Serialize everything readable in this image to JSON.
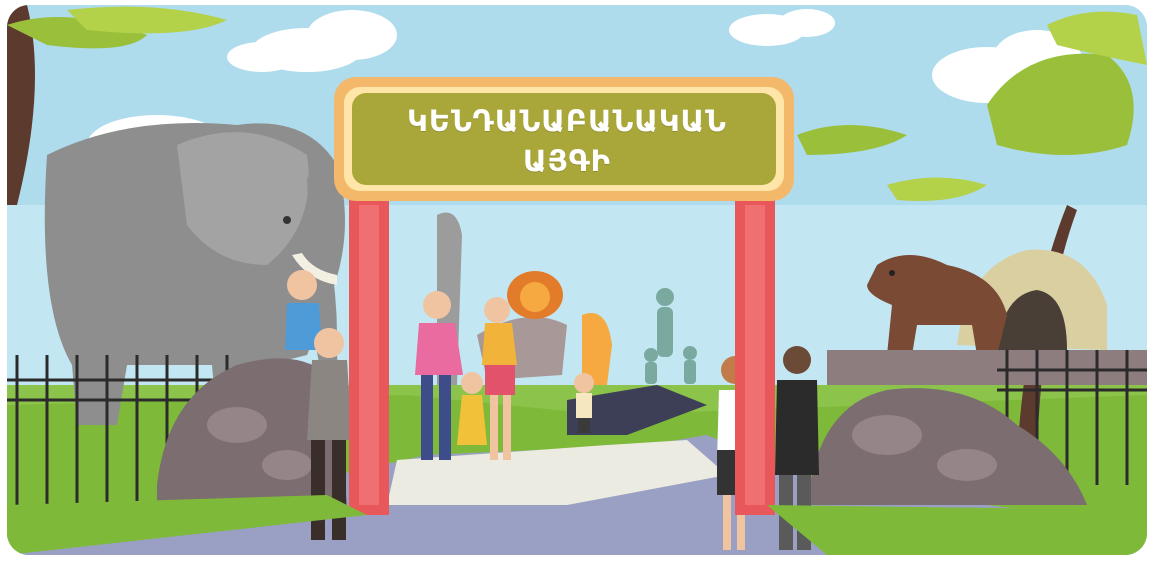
{
  "sign": {
    "line1": "ԿԵՆԴԱՆԱԲԱՆԱԿԱՆ",
    "line2": "ԱՅԳԻ"
  },
  "colors": {
    "sky": "#b8e3f0",
    "sign_board": "#a9a739",
    "sign_border": "#f4b86a",
    "pillar": "#e8585a",
    "grass": "#7fb93a",
    "path": "#e9e7dc"
  }
}
